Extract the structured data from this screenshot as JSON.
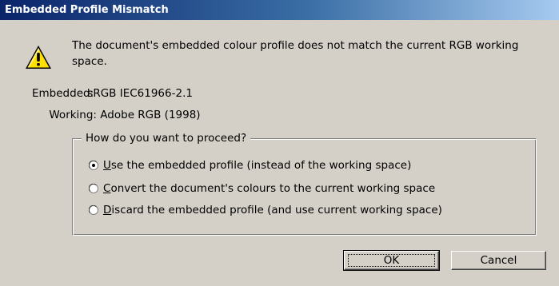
{
  "dialog": {
    "title": "Embedded Profile Mismatch",
    "message": "The document's embedded colour profile does not match the current RGB working space.",
    "icon": "warning-icon"
  },
  "profiles": {
    "embedded_label": "Embedded:",
    "embedded_value": "sRGB IEC61966-2.1",
    "working_label": "Working:",
    "working_value": "Adobe RGB (1998)"
  },
  "options": {
    "group_label": "How do you want to proceed?",
    "items": [
      {
        "label": "Use the embedded profile (instead of the working space)",
        "selected": true
      },
      {
        "label": "Convert the document's colours to the current working space",
        "selected": false
      },
      {
        "label": "Discard the embedded profile (and use current working space)",
        "selected": false
      }
    ]
  },
  "buttons": {
    "ok_label": "OK",
    "cancel_label": "Cancel"
  },
  "colors": {
    "titlebar_start": "#0a246a",
    "titlebar_end": "#a6caf0",
    "dialog_background": "#d4d0c8",
    "warning_yellow": "#ffe000"
  }
}
